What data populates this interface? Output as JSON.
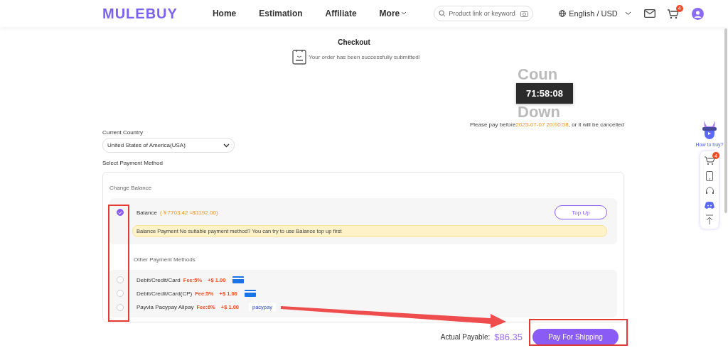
{
  "header": {
    "logo": "MULEBUY",
    "nav": [
      {
        "label": "Home"
      },
      {
        "label": "Estimation"
      },
      {
        "label": "Affiliate"
      },
      {
        "label": "More",
        "dropdown": true
      }
    ],
    "search": {
      "placeholder": "Product link or keyword"
    },
    "language": "English / USD",
    "cart_count": "4"
  },
  "checkout": {
    "title": "Checkout",
    "message": "Your order has been successfully submitted!",
    "countdown_top": "Coun",
    "timer": "71:58:08",
    "countdown_bottom": "Down",
    "deadline_prefix": "Please pay before",
    "deadline": "2025-07-07 20:00:58",
    "deadline_suffix": ", or it will be cancelled"
  },
  "country": {
    "label": "Current Country",
    "value": "United States of America(USA)"
  },
  "payment": {
    "label": "Select Payment Method",
    "balance_section": "Change Balance",
    "balance": {
      "label": "Balance",
      "amount": "(￥7703.42 ≈$1192.00)",
      "selected": true,
      "button": "Top Up",
      "notice": "Balance Payment  No suitable payment method? You can try to use Balance top up first"
    },
    "other_section": "Other Payment Methods",
    "methods": [
      {
        "label": "Debit/Credit/Card",
        "fee": "Fee:5%",
        "extra": "+$ 1.00",
        "kind": "card",
        "selected": false
      },
      {
        "label": "Debit/Credit/Card(CP)",
        "fee": "Fee:5%",
        "extra": "+$ 1.00",
        "kind": "card",
        "selected": false
      },
      {
        "label": "Payvia Pacypay Alipay",
        "fee": "Fee:6%",
        "extra": "+$ 1.00",
        "kind": "pacypay",
        "badge": "pacypay",
        "selected": false
      }
    ]
  },
  "footer": {
    "label": "Actual Payable:",
    "amount": "$86.35",
    "button": "Pay For Shipping"
  },
  "side_panel": {
    "caption": "How to buy?",
    "cart_count": "4"
  },
  "annotations": [
    {
      "kind": "box"
    },
    {
      "kind": "box"
    },
    {
      "kind": "arrow"
    }
  ]
}
